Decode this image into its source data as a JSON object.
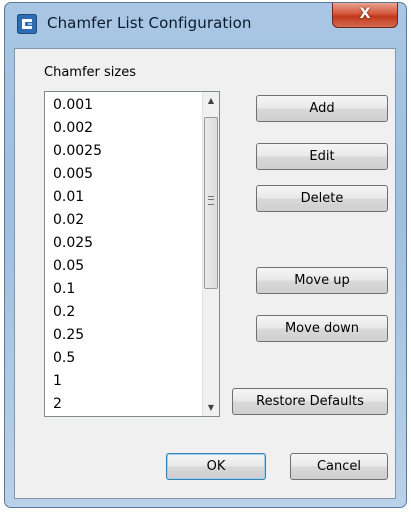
{
  "window": {
    "title": "Chamfer List Configuration",
    "close_label": "X",
    "app_icon": "app-icon"
  },
  "group_label": "Chamfer sizes",
  "list": {
    "items": [
      "0.001",
      "0.002",
      "0.0025",
      "0.005",
      "0.01",
      "0.02",
      "0.025",
      "0.05",
      "0.1",
      "0.2",
      "0.25",
      "0.5",
      "1",
      "2"
    ]
  },
  "buttons": {
    "add": "Add",
    "edit": "Edit",
    "delete": "Delete",
    "move_up": "Move up",
    "move_down": "Move down",
    "restore_defaults": "Restore Defaults",
    "ok": "OK",
    "cancel": "Cancel"
  },
  "colors": {
    "accent": "#3c7fb1",
    "close": "#c1381c",
    "frame": "#a9c7e4"
  }
}
